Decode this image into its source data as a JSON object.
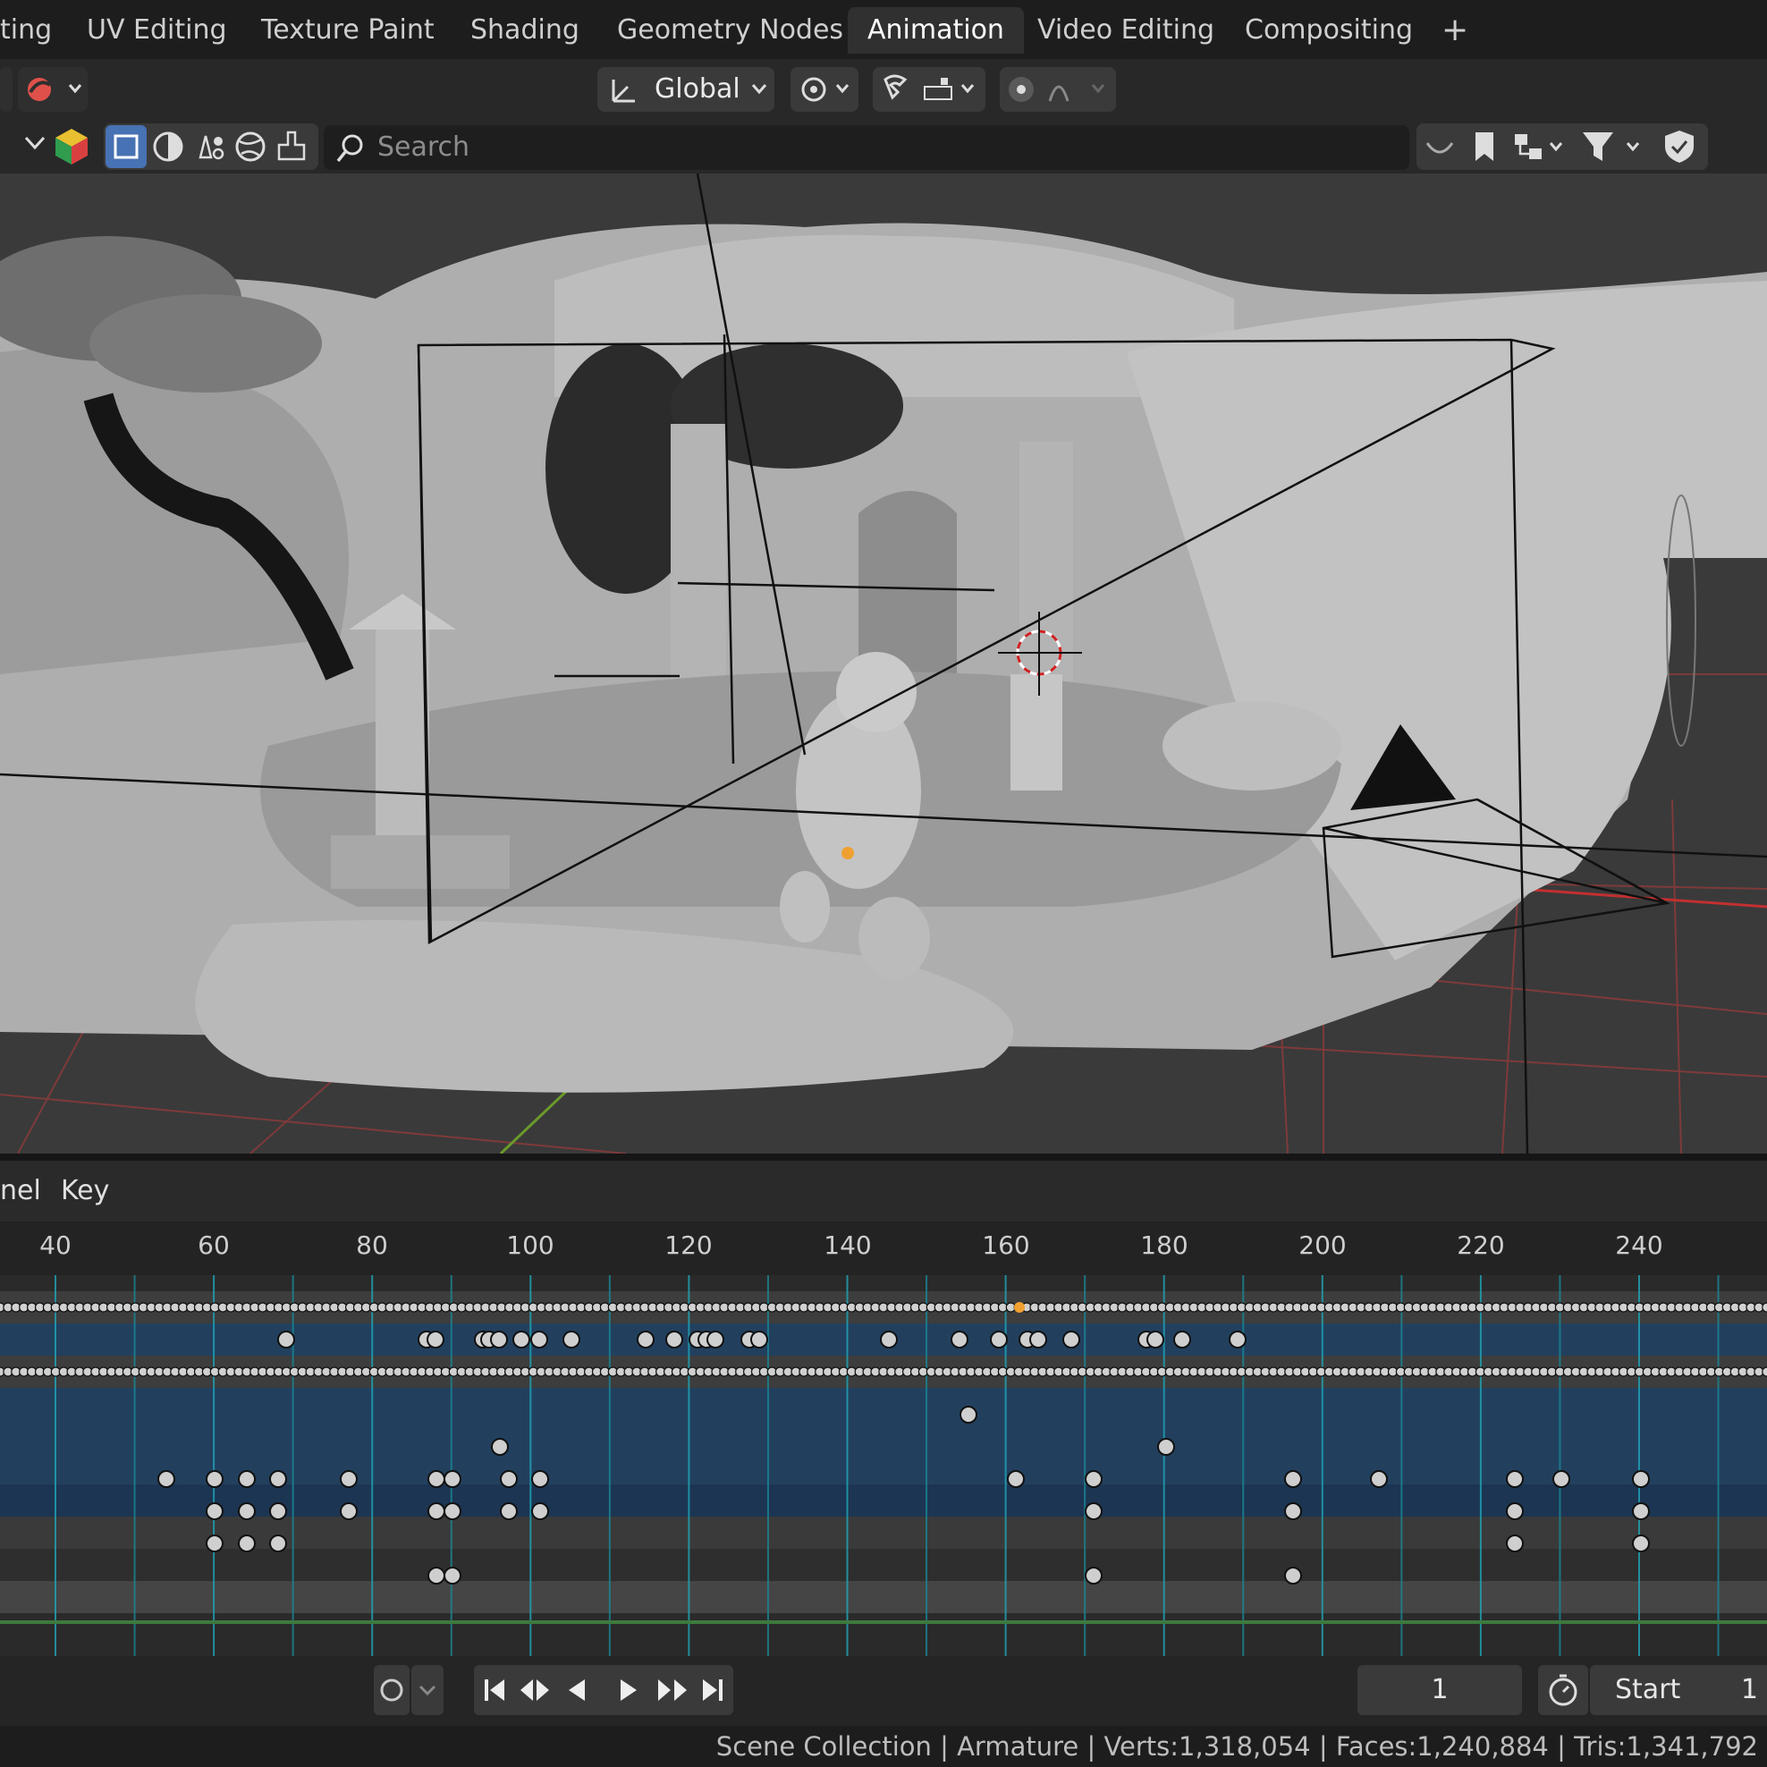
{
  "workspace_tabs": [
    "ting",
    "UV Editing",
    "Texture Paint",
    "Shading",
    "Geometry Nodes",
    "Animation",
    "Video Editing",
    "Compositing",
    "+"
  ],
  "active_tab": "Animation",
  "viewport_header": {
    "transform_orientation": "Global",
    "search_placeholder": "Search"
  },
  "timeline": {
    "menus": [
      "nel",
      "Key"
    ],
    "ruler_ticks": [
      "40",
      "60",
      "80",
      "100",
      "120",
      "140",
      "160",
      "180",
      "200",
      "220",
      "240"
    ],
    "current_frame": "1",
    "start_label": "Start",
    "start_value": "1"
  },
  "status_bar": {
    "text": "Scene Collection | Armature | Verts:1,318,054 | Faces:1,240,884 | Tris:1,341,792"
  },
  "colors": {
    "accent_tab": "#303030",
    "keyframe_row_blue": "#22405e",
    "grid_red": "#8a3a3a",
    "playhead_orange": "#f0a030"
  }
}
